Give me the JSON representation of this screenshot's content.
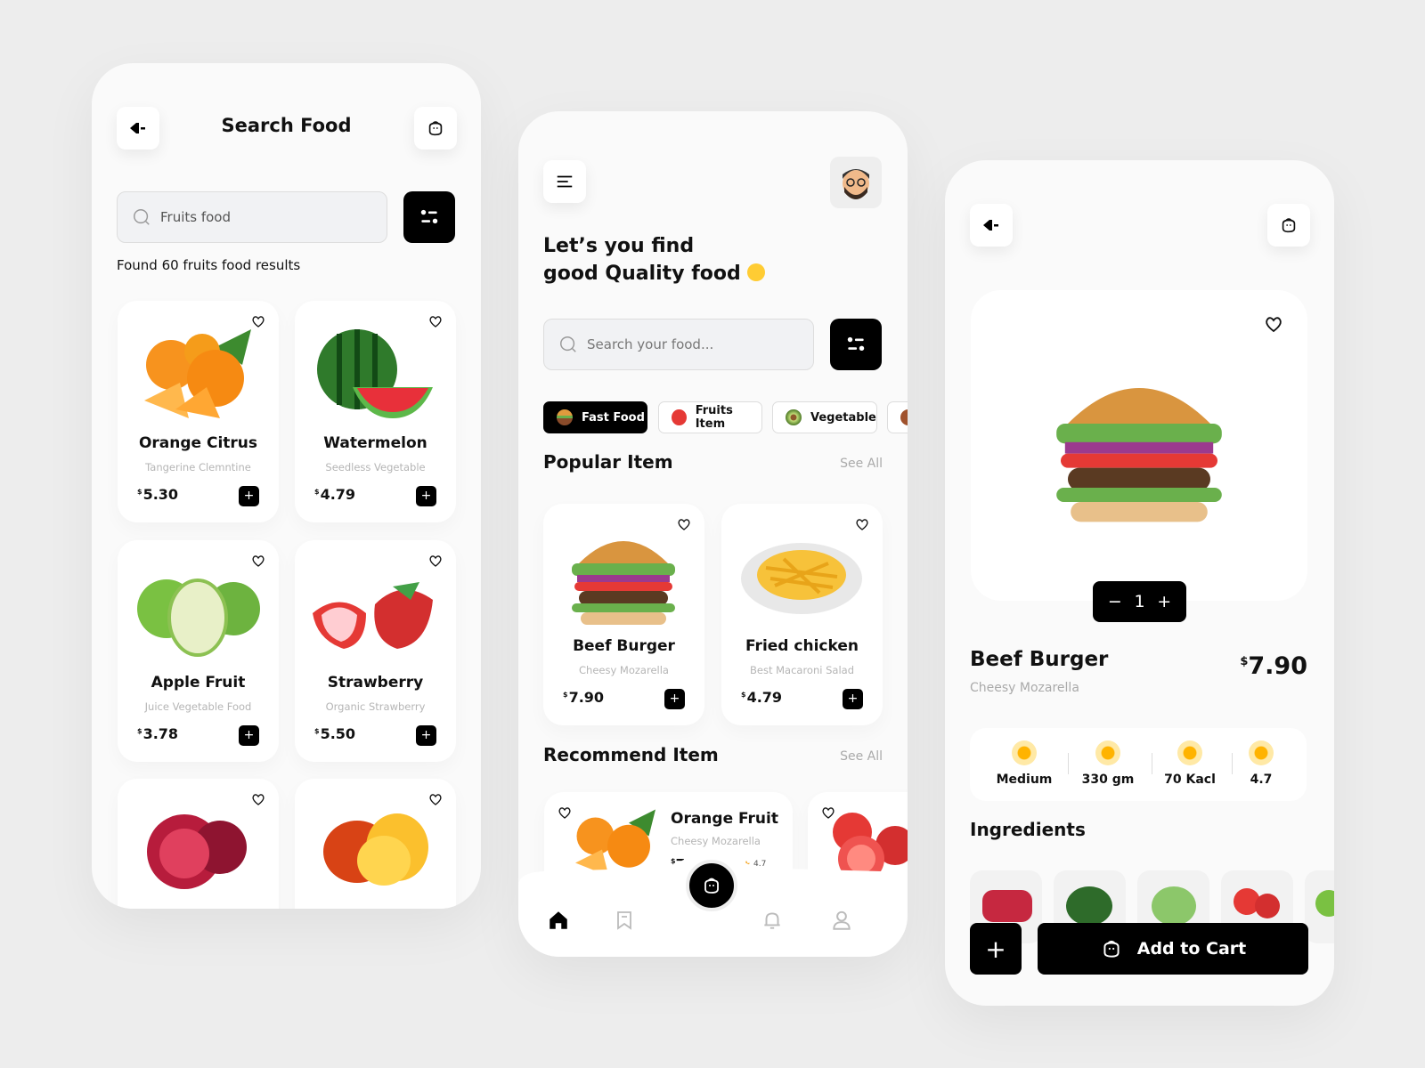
{
  "search_screen": {
    "title": "Search Food",
    "search_value": "Fruits food",
    "results_text": "Found 60 fruits food results",
    "items": [
      {
        "name": "Orange Citrus",
        "sub": "Tangerine Clemntine",
        "price": "5.30",
        "currency": "$",
        "image": "orange"
      },
      {
        "name": "Watermelon",
        "sub": "Seedless Vegetable",
        "price": "4.79",
        "currency": "$",
        "image": "watermelon"
      },
      {
        "name": "Apple Fruit",
        "sub": "Juice Vegetable Food",
        "price": "3.78",
        "currency": "$",
        "image": "apple"
      },
      {
        "name": "Strawberry",
        "sub": "Organic Strawberry",
        "price": "5.50",
        "currency": "$",
        "image": "strawberry"
      },
      {
        "image": "pomegranate"
      },
      {
        "image": "mango"
      }
    ],
    "add_label": "+"
  },
  "home_screen": {
    "heading_line1": "Let’s you find",
    "heading_line2": "good Quality food",
    "search_placeholder": "Search your food...",
    "categories": [
      {
        "label": "Fast Food",
        "active": true
      },
      {
        "label": "Fruits Item",
        "active": false
      },
      {
        "label": "Vegetable",
        "active": false
      }
    ],
    "popular_title": "Popular Item",
    "see_all": "See All",
    "popular": [
      {
        "name": "Beef Burger",
        "sub": "Cheesy Mozarella",
        "price": "7.90",
        "currency": "$"
      },
      {
        "name": "Fried chicken",
        "sub": "Best Macaroni Salad",
        "price": "4.79",
        "currency": "$"
      }
    ],
    "recommend_title": "Recommend Item",
    "recommend": [
      {
        "name": "Orange Fruit",
        "sub": "Cheesy Mozarella",
        "price": "7.9",
        "currency": "$",
        "rating": "4.7"
      }
    ],
    "nav": [
      "home-icon",
      "bookmark-icon",
      "cart-icon",
      "bell-icon",
      "user-icon"
    ]
  },
  "detail_screen": {
    "quantity": "1",
    "minus": "−",
    "plus": "+",
    "name": "Beef Burger",
    "sub": "Cheesy Mozarella",
    "currency": "$",
    "price": "7.90",
    "stats": [
      "Medium",
      "330 gm",
      "70 Kacl",
      "4.7"
    ],
    "ingredients_title": "Ingredients",
    "add_to_cart": "Add to Cart",
    "plus_button": "+"
  },
  "colors": {
    "accent": "#000000",
    "background": "#ededed",
    "stat_icon": "#ffb300"
  }
}
